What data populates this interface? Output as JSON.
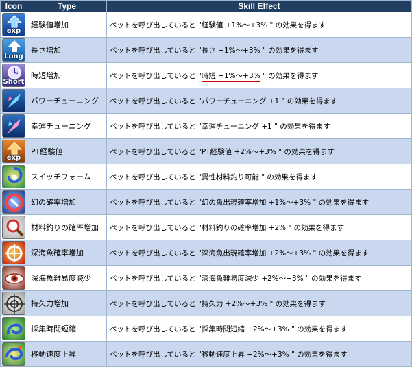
{
  "header": {
    "icon": "Icon",
    "type": "Type",
    "effect": "Skill Effect"
  },
  "rows": [
    {
      "type": "経験値増加",
      "effect_pre": "ペットを呼び出していると \"",
      "effect_hl": "経験値 +1%～+3%",
      "effect_post": " \" の効果を得ます",
      "highlight": false,
      "icon": "exp-arrow-icon",
      "icon_tag": "exp"
    },
    {
      "type": "長さ増加",
      "effect_pre": "ペットを呼び出していると \"",
      "effect_hl": "長さ +1%～+3%",
      "effect_post": " \" の効果を得ます",
      "highlight": false,
      "icon": "long-arrow-icon",
      "icon_tag": "Long"
    },
    {
      "type": "時短増加",
      "effect_pre": "ペットを呼び出していると \"",
      "effect_hl": "時短 +1%～+3%",
      "effect_post": " \" の効果を得ます",
      "highlight": true,
      "icon": "short-clock-icon",
      "icon_tag": "Short"
    },
    {
      "type": "パワーチューニング",
      "effect_pre": "ペットを呼び出していると \"",
      "effect_hl": "パワーチューニング +1",
      "effect_post": " \" の効果を得ます",
      "highlight": false,
      "icon": "power-tuning-icon",
      "icon_tag": ""
    },
    {
      "type": "幸運チューニング",
      "effect_pre": "ペットを呼び出していると \"",
      "effect_hl": "幸運チューニング +1",
      "effect_post": " \" の効果を得ます",
      "highlight": false,
      "icon": "luck-tuning-icon",
      "icon_tag": ""
    },
    {
      "type": "PT経験値",
      "effect_pre": "ペットを呼び出していると \"",
      "effect_hl": "PT経験値 +2%～+3%",
      "effect_post": " \" の効果を得ます",
      "highlight": false,
      "icon": "pt-exp-arrow-icon",
      "icon_tag": "exp"
    },
    {
      "type": "スイッチフォーム",
      "effect_pre": "ペットを呼び出していると \"",
      "effect_hl": "異性材料釣り可能",
      "effect_post": " \" の効果を得ます",
      "highlight": false,
      "icon": "switch-form-swirl-icon",
      "icon_tag": ""
    },
    {
      "type": "幻の確率増加",
      "effect_pre": "ペットを呼び出していると \"",
      "effect_hl": "幻の魚出現確率増加 +1%～+3%",
      "effect_post": " \" の効果を得ます",
      "highlight": false,
      "icon": "phantom-rate-circle-icon",
      "icon_tag": ""
    },
    {
      "type": "材料釣りの確率増加",
      "effect_pre": "ペットを呼び出していると \"",
      "effect_hl": "材料釣りの確率増加 +2%",
      "effect_post": " \" の効果を得ます",
      "highlight": false,
      "icon": "material-magnifier-icon",
      "icon_tag": ""
    },
    {
      "type": "深海魚確率増加",
      "effect_pre": "ペットを呼び出していると \"",
      "effect_hl": "深海魚出現確率増加 +2%～+3%",
      "effect_post": " \" の効果を得ます",
      "highlight": false,
      "icon": "deep-sea-rate-icon",
      "icon_tag": ""
    },
    {
      "type": "深海魚難易度減少",
      "effect_pre": "ペットを呼び出していると \"",
      "effect_hl": "深海魚難易度減少 +2%～+3%",
      "effect_post": " \" の効果を得ます",
      "highlight": false,
      "icon": "deep-sea-eye-icon",
      "icon_tag": ""
    },
    {
      "type": "持久力増加",
      "effect_pre": "ペットを呼び出していると \"",
      "effect_hl": "持久力 +2%～+3%",
      "effect_post": " \" の効果を得ます",
      "highlight": false,
      "icon": "endurance-crosshair-icon",
      "icon_tag": ""
    },
    {
      "type": "採集時間短縮",
      "effect_pre": "ペットを呼び出していると \"",
      "effect_hl": "採集時間短縮 +2%～+3%",
      "effect_post": " \" の効果を得ます",
      "highlight": false,
      "icon": "gather-time-swirl-icon",
      "icon_tag": ""
    },
    {
      "type": "移動速度上昇",
      "effect_pre": "ペットを呼び出していると \"",
      "effect_hl": "移動速度上昇 +2%～+3%",
      "effect_post": " \" の効果を得ます",
      "highlight": false,
      "icon": "move-speed-swirl-icon",
      "icon_tag": ""
    }
  ],
  "colors": {
    "header_bg": "#213e63",
    "alt_row": "#c9d8ee",
    "highlight_underline": "#d40000"
  }
}
